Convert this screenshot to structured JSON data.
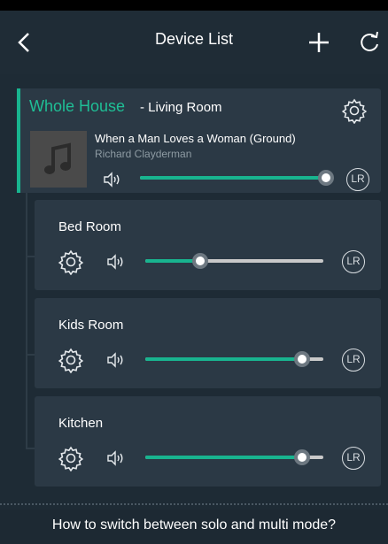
{
  "header": {
    "title": "Device List",
    "back_icon": "chevron-left-icon",
    "add_icon": "plus-icon",
    "refresh_icon": "refresh-icon"
  },
  "master": {
    "group_name": "Whole House",
    "room_label": "- Living Room",
    "song_title": "When a Man Loves a Woman (Ground)",
    "artist": "Richard Clayderman",
    "volume": 1.0,
    "channel": "LR",
    "accent_color": "#18b48f"
  },
  "rooms": [
    {
      "name": "Bed Room",
      "volume": 0.31,
      "channel": "LR"
    },
    {
      "name": "Kids Room",
      "volume": 0.88,
      "channel": "LR"
    },
    {
      "name": "Kitchen",
      "volume": 0.88,
      "channel": "LR"
    }
  ],
  "footer": {
    "help_text": "How to switch between solo and multi mode?"
  }
}
